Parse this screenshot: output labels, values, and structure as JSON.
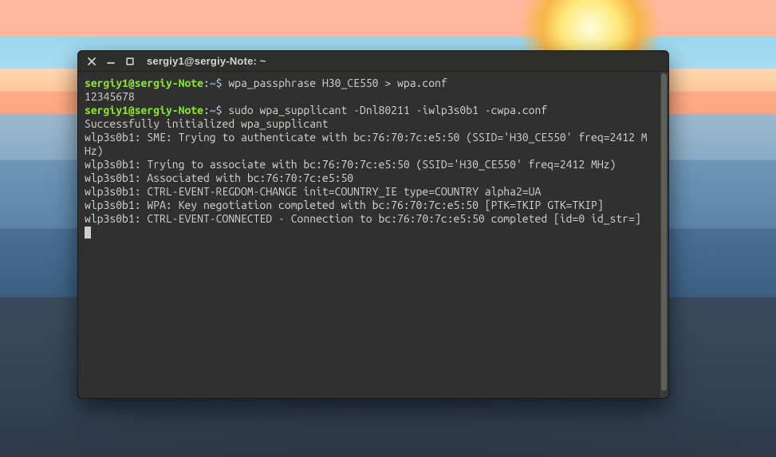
{
  "window": {
    "title": "sergiy1@sergiy-Note: ~"
  },
  "prompt": {
    "user_host": "sergiy1@sergiy-Note",
    "colon": ":",
    "path": "~",
    "symbol": "$"
  },
  "commands": {
    "cmd1": "wpa_passphrase H30_CE550 > wpa.conf",
    "input1": "12345678",
    "cmd2": "sudo wpa_supplicant -Dnl80211 -iwlp3s0b1 -cwpa.conf"
  },
  "output": {
    "l1": "Successfully initialized wpa_supplicant",
    "l2": "wlp3s0b1: SME: Trying to authenticate with bc:76:70:7c:e5:50 (SSID='H30_CE550' freq=2412 MHz)",
    "l3": "wlp3s0b1: Trying to associate with bc:76:70:7c:e5:50 (SSID='H30_CE550' freq=2412 MHz)",
    "l4": "wlp3s0b1: Associated with bc:76:70:7c:e5:50",
    "l5": "wlp3s0b1: CTRL-EVENT-REGDOM-CHANGE init=COUNTRY_IE type=COUNTRY alpha2=UA",
    "l6": "wlp3s0b1: WPA: Key negotiation completed with bc:76:70:7c:e5:50 [PTK=TKIP GTK=TKIP]",
    "l7": "wlp3s0b1: CTRL-EVENT-CONNECTED - Connection to bc:76:70:7c:e5:50 completed [id=0 id_str=]"
  }
}
